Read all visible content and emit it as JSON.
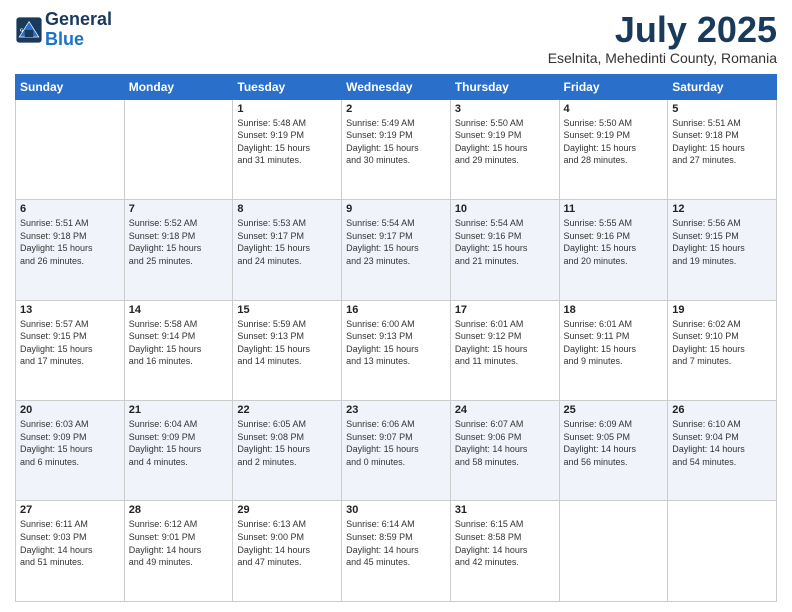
{
  "header": {
    "logo_line1": "General",
    "logo_line2": "Blue",
    "month_year": "July 2025",
    "location": "Eselnita, Mehedinti County, Romania"
  },
  "days_of_week": [
    "Sunday",
    "Monday",
    "Tuesday",
    "Wednesday",
    "Thursday",
    "Friday",
    "Saturday"
  ],
  "weeks": [
    [
      {
        "day": "",
        "info": ""
      },
      {
        "day": "",
        "info": ""
      },
      {
        "day": "1",
        "info": "Sunrise: 5:48 AM\nSunset: 9:19 PM\nDaylight: 15 hours\nand 31 minutes."
      },
      {
        "day": "2",
        "info": "Sunrise: 5:49 AM\nSunset: 9:19 PM\nDaylight: 15 hours\nand 30 minutes."
      },
      {
        "day": "3",
        "info": "Sunrise: 5:50 AM\nSunset: 9:19 PM\nDaylight: 15 hours\nand 29 minutes."
      },
      {
        "day": "4",
        "info": "Sunrise: 5:50 AM\nSunset: 9:19 PM\nDaylight: 15 hours\nand 28 minutes."
      },
      {
        "day": "5",
        "info": "Sunrise: 5:51 AM\nSunset: 9:18 PM\nDaylight: 15 hours\nand 27 minutes."
      }
    ],
    [
      {
        "day": "6",
        "info": "Sunrise: 5:51 AM\nSunset: 9:18 PM\nDaylight: 15 hours\nand 26 minutes."
      },
      {
        "day": "7",
        "info": "Sunrise: 5:52 AM\nSunset: 9:18 PM\nDaylight: 15 hours\nand 25 minutes."
      },
      {
        "day": "8",
        "info": "Sunrise: 5:53 AM\nSunset: 9:17 PM\nDaylight: 15 hours\nand 24 minutes."
      },
      {
        "day": "9",
        "info": "Sunrise: 5:54 AM\nSunset: 9:17 PM\nDaylight: 15 hours\nand 23 minutes."
      },
      {
        "day": "10",
        "info": "Sunrise: 5:54 AM\nSunset: 9:16 PM\nDaylight: 15 hours\nand 21 minutes."
      },
      {
        "day": "11",
        "info": "Sunrise: 5:55 AM\nSunset: 9:16 PM\nDaylight: 15 hours\nand 20 minutes."
      },
      {
        "day": "12",
        "info": "Sunrise: 5:56 AM\nSunset: 9:15 PM\nDaylight: 15 hours\nand 19 minutes."
      }
    ],
    [
      {
        "day": "13",
        "info": "Sunrise: 5:57 AM\nSunset: 9:15 PM\nDaylight: 15 hours\nand 17 minutes."
      },
      {
        "day": "14",
        "info": "Sunrise: 5:58 AM\nSunset: 9:14 PM\nDaylight: 15 hours\nand 16 minutes."
      },
      {
        "day": "15",
        "info": "Sunrise: 5:59 AM\nSunset: 9:13 PM\nDaylight: 15 hours\nand 14 minutes."
      },
      {
        "day": "16",
        "info": "Sunrise: 6:00 AM\nSunset: 9:13 PM\nDaylight: 15 hours\nand 13 minutes."
      },
      {
        "day": "17",
        "info": "Sunrise: 6:01 AM\nSunset: 9:12 PM\nDaylight: 15 hours\nand 11 minutes."
      },
      {
        "day": "18",
        "info": "Sunrise: 6:01 AM\nSunset: 9:11 PM\nDaylight: 15 hours\nand 9 minutes."
      },
      {
        "day": "19",
        "info": "Sunrise: 6:02 AM\nSunset: 9:10 PM\nDaylight: 15 hours\nand 7 minutes."
      }
    ],
    [
      {
        "day": "20",
        "info": "Sunrise: 6:03 AM\nSunset: 9:09 PM\nDaylight: 15 hours\nand 6 minutes."
      },
      {
        "day": "21",
        "info": "Sunrise: 6:04 AM\nSunset: 9:09 PM\nDaylight: 15 hours\nand 4 minutes."
      },
      {
        "day": "22",
        "info": "Sunrise: 6:05 AM\nSunset: 9:08 PM\nDaylight: 15 hours\nand 2 minutes."
      },
      {
        "day": "23",
        "info": "Sunrise: 6:06 AM\nSunset: 9:07 PM\nDaylight: 15 hours\nand 0 minutes."
      },
      {
        "day": "24",
        "info": "Sunrise: 6:07 AM\nSunset: 9:06 PM\nDaylight: 14 hours\nand 58 minutes."
      },
      {
        "day": "25",
        "info": "Sunrise: 6:09 AM\nSunset: 9:05 PM\nDaylight: 14 hours\nand 56 minutes."
      },
      {
        "day": "26",
        "info": "Sunrise: 6:10 AM\nSunset: 9:04 PM\nDaylight: 14 hours\nand 54 minutes."
      }
    ],
    [
      {
        "day": "27",
        "info": "Sunrise: 6:11 AM\nSunset: 9:03 PM\nDaylight: 14 hours\nand 51 minutes."
      },
      {
        "day": "28",
        "info": "Sunrise: 6:12 AM\nSunset: 9:01 PM\nDaylight: 14 hours\nand 49 minutes."
      },
      {
        "day": "29",
        "info": "Sunrise: 6:13 AM\nSunset: 9:00 PM\nDaylight: 14 hours\nand 47 minutes."
      },
      {
        "day": "30",
        "info": "Sunrise: 6:14 AM\nSunset: 8:59 PM\nDaylight: 14 hours\nand 45 minutes."
      },
      {
        "day": "31",
        "info": "Sunrise: 6:15 AM\nSunset: 8:58 PM\nDaylight: 14 hours\nand 42 minutes."
      },
      {
        "day": "",
        "info": ""
      },
      {
        "day": "",
        "info": ""
      }
    ]
  ]
}
